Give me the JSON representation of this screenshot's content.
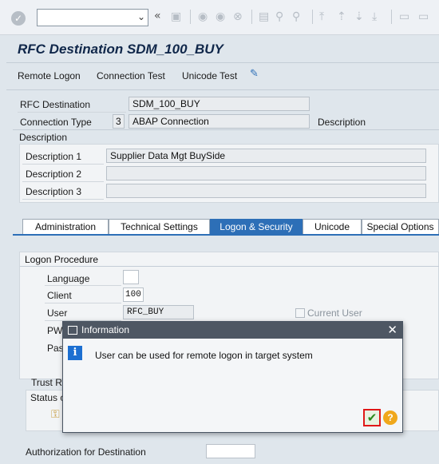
{
  "toolbar": {
    "icons": [
      "enter-icon",
      "back-icon",
      "save-icon",
      "nav-back-icon",
      "exit-icon",
      "cancel-icon",
      "print-icon",
      "find-icon",
      "find-next-icon",
      "first-page-icon",
      "prev-page-icon",
      "next-page-icon",
      "last-page-icon",
      "new-session-icon",
      "shortcut-icon"
    ]
  },
  "page": {
    "title": "RFC Destination SDM_100_BUY"
  },
  "app_toolbar": {
    "remote_logon": "Remote Logon",
    "connection_test": "Connection Test",
    "unicode_test": "Unicode Test"
  },
  "header_fields": {
    "rfc_destination_label": "RFC Destination",
    "rfc_destination_value": "SDM_100_BUY",
    "connection_type_label": "Connection Type",
    "connection_type_code": "3",
    "connection_type_value": "ABAP Connection",
    "description_label": "Description"
  },
  "description_section": {
    "heading": "Description",
    "desc1_label": "Description 1",
    "desc1_value": "Supplier Data Mgt BuySide",
    "desc2_label": "Description 2",
    "desc2_value": "",
    "desc3_label": "Description 3",
    "desc3_value": ""
  },
  "tabs": [
    "Administration",
    "Technical Settings",
    "Logon & Security",
    "Unicode",
    "Special Options"
  ],
  "active_tab": "Logon & Security",
  "logon_procedure": {
    "heading": "Logon Procedure",
    "language_label": "Language",
    "language_value": "",
    "client_label": "Client",
    "client_value": "100",
    "user_label": "User",
    "user_value": "RFC_BUY",
    "current_user_label": "Current User",
    "pw_label": "PW",
    "pass_label": "Pas"
  },
  "lower_section": {
    "trust_label": "Trust R",
    "status_label": "Status c",
    "authorization_label": "Authorization for Destination"
  },
  "dialog": {
    "title": "Information",
    "message": "User can be used for remote logon in target system"
  },
  "colors": {
    "active_tab": "#2d6fb7",
    "dialog_header": "#4e5763",
    "ok_border": "#e01818",
    "title_text": "#10274a"
  }
}
